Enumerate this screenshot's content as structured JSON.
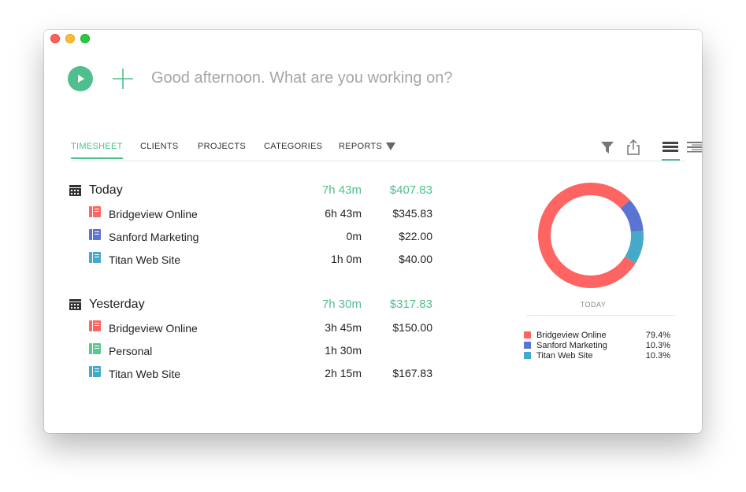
{
  "window": {
    "greeting_placeholder": "Good afternoon. What are you working on?"
  },
  "tabs": [
    {
      "label": "TIMESHEET",
      "active": true
    },
    {
      "label": "CLIENTS"
    },
    {
      "label": "PROJECTS"
    },
    {
      "label": "CATEGORIES"
    },
    {
      "label": "REPORTS"
    }
  ],
  "toolbar_icons": [
    "filter-icon",
    "share-icon",
    "list-view-full-icon",
    "list-view-compact-icon",
    "list-view-minimal-icon"
  ],
  "groups": [
    {
      "title": "Today",
      "total_time": "7h 43m",
      "total_amount": "$407.83",
      "rows": [
        {
          "name": "Bridgeview Online",
          "time": "6h 43m",
          "amount": "$345.83",
          "color": "#fe6461"
        },
        {
          "name": "Sanford Marketing",
          "time": "0m",
          "amount": "$22.00",
          "color": "#5b73d2"
        },
        {
          "name": "Titan Web Site",
          "time": "1h 0m",
          "amount": "$40.00",
          "color": "#45a9c9"
        }
      ]
    },
    {
      "title": "Yesterday",
      "total_time": "7h 30m",
      "total_amount": "$317.83",
      "rows": [
        {
          "name": "Bridgeview Online",
          "time": "3h 45m",
          "amount": "$150.00",
          "color": "#fe6461"
        },
        {
          "name": "Personal",
          "time": "1h 30m",
          "amount": "",
          "color": "#5cc594"
        },
        {
          "name": "Titan Web Site",
          "time": "2h 15m",
          "amount": "$167.83",
          "color": "#45a9c9"
        }
      ]
    }
  ],
  "chart_data": {
    "type": "pie",
    "title": "TODAY",
    "categories": [
      "Bridgeview Online",
      "Sanford Marketing",
      "Titan Web Site"
    ],
    "values": [
      79.4,
      10.3,
      10.3
    ],
    "labels": [
      "79.4%",
      "10.3%",
      "10.3%"
    ],
    "colors": [
      "#fe6461",
      "#5b73d2",
      "#45a9c9"
    ]
  }
}
